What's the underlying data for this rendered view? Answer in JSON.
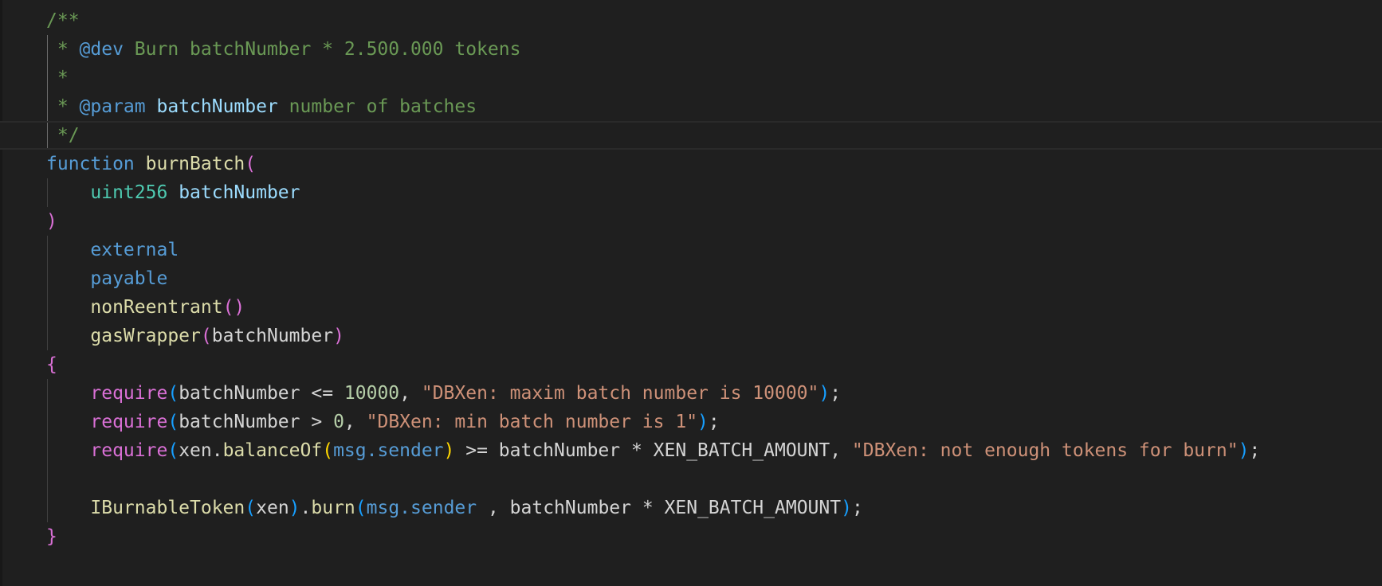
{
  "editor": {
    "language": "solidity",
    "colors": {
      "background": "#1f1f1f",
      "comment": "#6a9955",
      "keyword": "#569cd6",
      "type": "#4ec9b0",
      "function": "#dcdcaa",
      "parameter": "#9cdcfe",
      "number": "#b5cea8",
      "string": "#ce9178",
      "bracket_level1": "#da70d6",
      "bracket_level2": "#179fff",
      "bracket_level3": "#ffd700"
    },
    "lines": [
      {
        "tokens": [
          {
            "text": "/**"
          }
        ]
      },
      {
        "tokens": [
          {
            "text": " * "
          },
          {
            "text": "@dev"
          },
          {
            "text": " Burn batchNumber * 2.500.000 tokens"
          }
        ]
      },
      {
        "tokens": [
          {
            "text": " *"
          }
        ]
      },
      {
        "tokens": [
          {
            "text": " * "
          },
          {
            "text": "@param"
          },
          {
            "text": " "
          },
          {
            "text": "batchNumber"
          },
          {
            "text": " number of batches"
          }
        ]
      },
      {
        "tokens": [
          {
            "text": " */"
          }
        ]
      },
      {
        "tokens": [
          {
            "text": "function"
          },
          {
            "text": " "
          },
          {
            "text": "burnBatch"
          },
          {
            "text": "("
          }
        ]
      },
      {
        "tokens": [
          {
            "text": "    "
          },
          {
            "text": "uint256"
          },
          {
            "text": " "
          },
          {
            "text": "batchNumber"
          }
        ]
      },
      {
        "tokens": [
          {
            "text": ")"
          }
        ]
      },
      {
        "tokens": [
          {
            "text": "    "
          },
          {
            "text": "external"
          }
        ]
      },
      {
        "tokens": [
          {
            "text": "    "
          },
          {
            "text": "payable"
          }
        ]
      },
      {
        "tokens": [
          {
            "text": "    "
          },
          {
            "text": "nonReentrant"
          },
          {
            "text": "()"
          }
        ]
      },
      {
        "tokens": [
          {
            "text": "    "
          },
          {
            "text": "gasWrapper"
          },
          {
            "text": "("
          },
          {
            "text": "batchNumber"
          },
          {
            "text": ")"
          }
        ]
      },
      {
        "tokens": [
          {
            "text": "{"
          }
        ]
      },
      {
        "tokens": [
          {
            "text": "    "
          },
          {
            "text": "require"
          },
          {
            "text": "("
          },
          {
            "text": "batchNumber <= "
          },
          {
            "text": "10000"
          },
          {
            "text": ", "
          },
          {
            "text": "\"DBXen: maxim batch number is 10000\""
          },
          {
            "text": ")"
          },
          {
            "text": ";"
          }
        ]
      },
      {
        "tokens": [
          {
            "text": "    "
          },
          {
            "text": "require"
          },
          {
            "text": "("
          },
          {
            "text": "batchNumber > "
          },
          {
            "text": "0"
          },
          {
            "text": ", "
          },
          {
            "text": "\"DBXen: min batch number is 1\""
          },
          {
            "text": ")"
          },
          {
            "text": ";"
          }
        ]
      },
      {
        "tokens": [
          {
            "text": "    "
          },
          {
            "text": "require"
          },
          {
            "text": "("
          },
          {
            "text": "xen."
          },
          {
            "text": "balanceOf"
          },
          {
            "text": "("
          },
          {
            "text": "msg.sender"
          },
          {
            "text": ")"
          },
          {
            "text": " >= batchNumber * XEN_BATCH_AMOUNT, "
          },
          {
            "text": "\"DBXen: not enough tokens for burn\""
          },
          {
            "text": ")"
          },
          {
            "text": ";"
          }
        ]
      },
      {
        "tokens": [
          {
            "text": ""
          }
        ]
      },
      {
        "tokens": [
          {
            "text": "    "
          },
          {
            "text": "IBurnableToken"
          },
          {
            "text": "("
          },
          {
            "text": "xen"
          },
          {
            "text": ")"
          },
          {
            "text": "."
          },
          {
            "text": "burn"
          },
          {
            "text": "("
          },
          {
            "text": "msg.sender"
          },
          {
            "text": " , batchNumber * XEN_BATCH_AMOUNT"
          },
          {
            "text": ")"
          },
          {
            "text": ";"
          }
        ]
      },
      {
        "tokens": [
          {
            "text": "}"
          }
        ]
      }
    ]
  }
}
